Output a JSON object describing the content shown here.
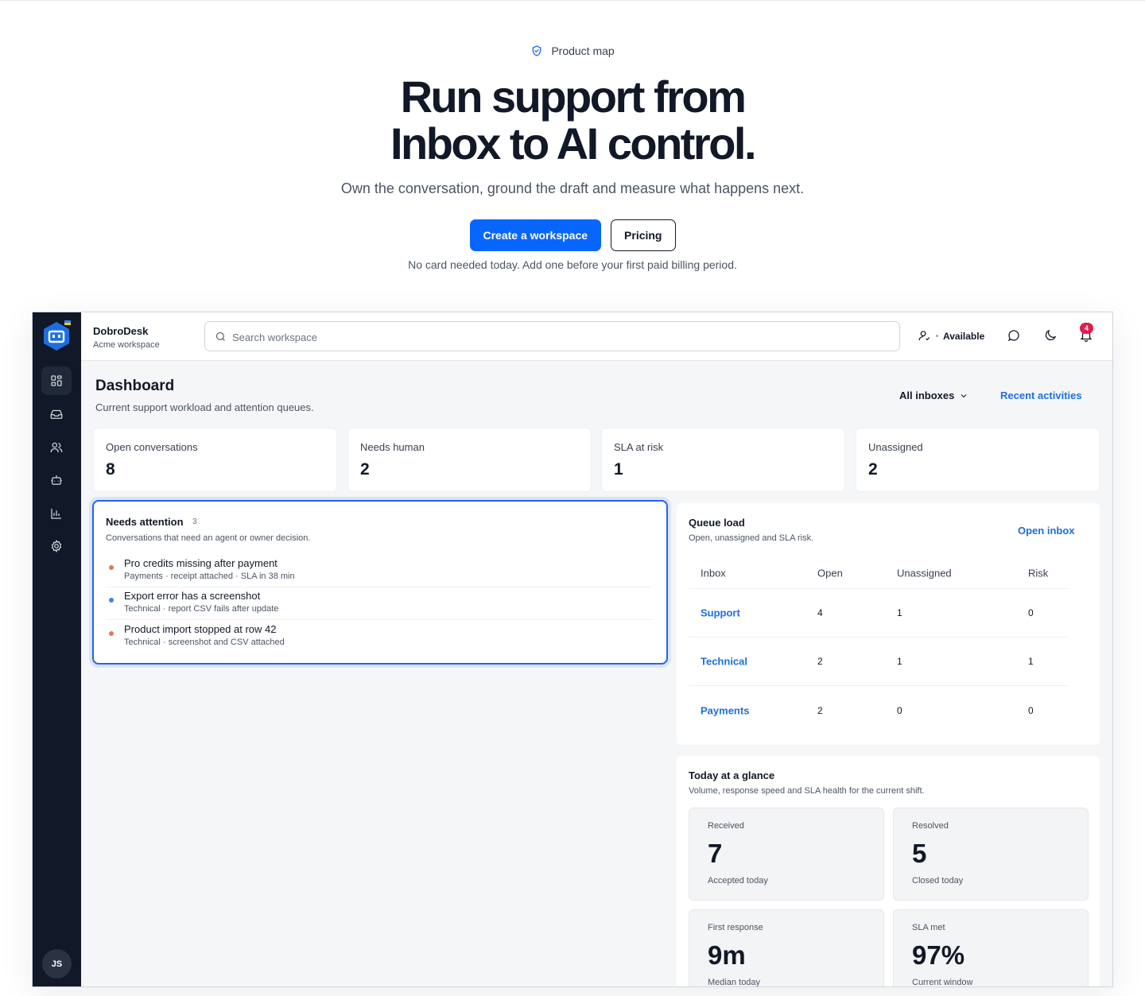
{
  "hero": {
    "eyebrow": "Product map",
    "title_line1": "Run support from",
    "title_line2": "Inbox to AI control.",
    "subtitle": "Own the conversation, ground the draft and measure what happens next.",
    "cta_primary": "Create a workspace",
    "cta_secondary": "Pricing",
    "note": "No card needed today. Add one before your first paid billing period."
  },
  "colors": {
    "primary": "#0866ff",
    "link": "#1d6fe0",
    "rail": "#111827",
    "focus": "#2563eb",
    "badge": "#e11d48"
  },
  "app": {
    "workspace_name": "DobroDesk",
    "workspace_sub": "Acme workspace",
    "search_placeholder": "Search workspace",
    "status_label": "Available",
    "notification_count": "4",
    "avatar_initials": "JS",
    "nav_icons": [
      "dashboard-icon",
      "inbox-icon",
      "users-icon",
      "bot-icon",
      "analytics-icon",
      "settings-icon"
    ]
  },
  "dashboard": {
    "title": "Dashboard",
    "subtitle": "Current support workload and attention queues.",
    "filter_label": "All inboxes",
    "recent_link": "Recent activities",
    "stats": [
      {
        "label": "Open conversations",
        "value": "8"
      },
      {
        "label": "Needs human",
        "value": "2"
      },
      {
        "label": "SLA at risk",
        "value": "1"
      },
      {
        "label": "Unassigned",
        "value": "2"
      }
    ]
  },
  "attention": {
    "title": "Needs attention",
    "count": "3",
    "subtitle": "Conversations that need an agent or owner decision.",
    "items": [
      {
        "title": "Pro credits missing after payment",
        "meta": "Payments · receipt attached · SLA in 38 min",
        "dot_color": "#e07a4f"
      },
      {
        "title": "Export error has a screenshot",
        "meta": "Technical · report CSV fails after update",
        "dot_color": "#3b82f6"
      },
      {
        "title": "Product import stopped at row 42",
        "meta": "Technical · screenshot and CSV attached",
        "dot_color": "#e07a4f"
      }
    ]
  },
  "queue": {
    "title": "Queue load",
    "subtitle": "Open, unassigned and SLA risk.",
    "link": "Open inbox",
    "headers": [
      "Inbox",
      "Open",
      "Unassigned",
      "Risk"
    ],
    "rows": [
      [
        "Support",
        "4",
        "1",
        "0"
      ],
      [
        "Technical",
        "2",
        "1",
        "1"
      ],
      [
        "Payments",
        "2",
        "0",
        "0"
      ]
    ]
  },
  "glance": {
    "title": "Today at a glance",
    "subtitle": "Volume, response speed and SLA health for the current shift.",
    "tiles": [
      {
        "label": "Received",
        "value": "7",
        "note": "Accepted today"
      },
      {
        "label": "Resolved",
        "value": "5",
        "note": "Closed today"
      },
      {
        "label": "First response",
        "value": "9m",
        "note": "Median today"
      },
      {
        "label": "SLA met",
        "value": "97%",
        "note": "Current window"
      }
    ]
  }
}
